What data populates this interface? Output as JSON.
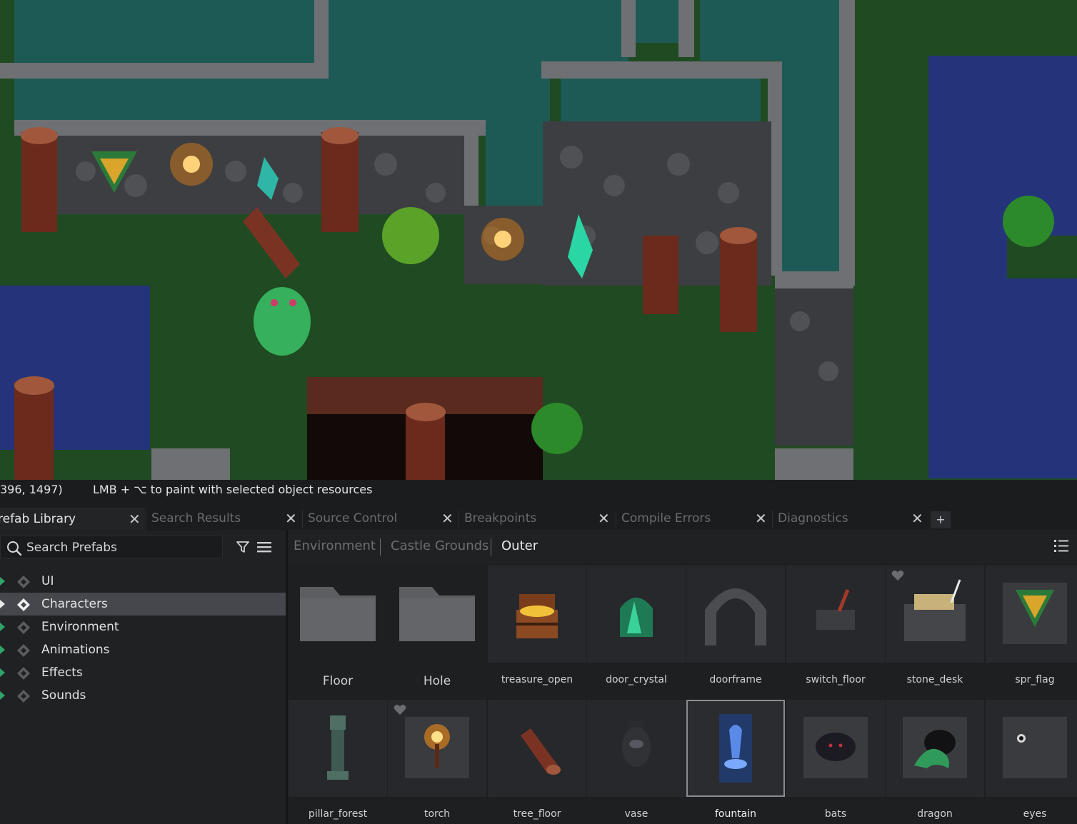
{
  "statusbar": {
    "coords": "396, 1497)",
    "hint": "LMB + ⌥ to paint with selected object resources"
  },
  "tabs": [
    {
      "label": "refab Library",
      "active": true
    },
    {
      "label": "Search Results",
      "active": false
    },
    {
      "label": "Source Control",
      "active": false
    },
    {
      "label": "Breakpoints",
      "active": false
    },
    {
      "label": "Compile Errors",
      "active": false
    },
    {
      "label": "Diagnostics",
      "active": false
    }
  ],
  "tab_close_glyph": "✕",
  "tab_add_glyph": "+",
  "search": {
    "placeholder": "Search Prefabs",
    "icon": "search-icon"
  },
  "toolbar": {
    "filter_icon": "filter-icon",
    "menu_icon": "hamburger-menu-icon"
  },
  "tree": [
    {
      "label": "UI",
      "selected": false
    },
    {
      "label": "Characters",
      "selected": true
    },
    {
      "label": "Environment",
      "selected": false
    },
    {
      "label": "Animations",
      "selected": false
    },
    {
      "label": "Effects",
      "selected": false
    },
    {
      "label": "Sounds",
      "selected": false
    }
  ],
  "breadcrumb": [
    {
      "label": "Environment"
    },
    {
      "label": "Castle Grounds"
    },
    {
      "label": "Outer",
      "current": true
    }
  ],
  "view_toggle_icon": "list-view-icon",
  "assets_row1": [
    {
      "name": "Floor",
      "type": "folder"
    },
    {
      "name": "Hole",
      "type": "folder"
    },
    {
      "name": "treasure_open",
      "icon": "treasure-chest-icon"
    },
    {
      "name": "door_crystal",
      "icon": "crystal-door-icon"
    },
    {
      "name": "doorframe",
      "icon": "stone-arch-icon"
    },
    {
      "name": "switch_floor",
      "icon": "floor-switch-icon"
    },
    {
      "name": "stone_desk",
      "icon": "stone-desk-icon",
      "favorite": true
    },
    {
      "name": "spr_flag",
      "icon": "banner-flag-icon"
    }
  ],
  "assets_row2": [
    {
      "name": "pillar_forest",
      "icon": "stone-pillar-icon"
    },
    {
      "name": "torch",
      "icon": "torch-icon",
      "favorite": true
    },
    {
      "name": "tree_floor",
      "icon": "fallen-log-icon"
    },
    {
      "name": "vase",
      "icon": "vase-icon"
    },
    {
      "name": "fountain",
      "icon": "fountain-icon",
      "selected": true
    },
    {
      "name": "bats",
      "icon": "bats-icon"
    },
    {
      "name": "dragon",
      "icon": "dragon-icon"
    },
    {
      "name": "eyes",
      "icon": "eyes-icon"
    }
  ],
  "colors": {
    "accent_green": "#2fa36a",
    "grass": "#1f4a22",
    "water_teal": "#1d5a55",
    "water_blue": "#25347a",
    "stone": "#4a4b4e",
    "panel_bg": "#1e1f21"
  }
}
